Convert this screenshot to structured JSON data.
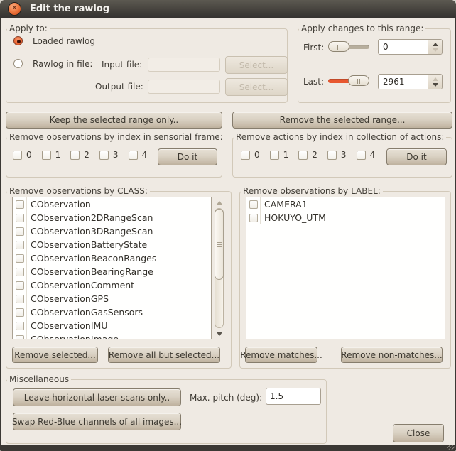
{
  "window": {
    "title": "Edit the rawlog",
    "close_glyph": "✕"
  },
  "apply_to": {
    "label": "Apply to:",
    "radio_loaded_label": "Loaded rawlog",
    "radio_file_label": "Rawlog in file:",
    "input_file_label": "Input file:",
    "output_file_label": "Output file:",
    "input_file_value": "",
    "output_file_value": "",
    "select_input_label": "Select...",
    "select_output_label": "Select..."
  },
  "range": {
    "label": "Apply changes to this range:",
    "first_label": "First:",
    "first_value": "0",
    "last_label": "Last:",
    "last_value": "2961"
  },
  "range_buttons": {
    "keep_label": "Keep the selected range only..",
    "remove_label": "Remove the selected range..."
  },
  "sensorial": {
    "label": "Remove observations by index in sensorial frame:",
    "indices": [
      "0",
      "1",
      "2",
      "3",
      "4"
    ],
    "do_it_label": "Do it"
  },
  "actions": {
    "label": "Remove actions by index in collection of actions:",
    "indices": [
      "0",
      "1",
      "2",
      "3",
      "4"
    ],
    "do_it_label": "Do it"
  },
  "by_class": {
    "label": "Remove observations by CLASS:",
    "items": [
      "CObservation",
      "CObservation2DRangeScan",
      "CObservation3DRangeScan",
      "CObservationBatteryState",
      "CObservationBeaconRanges",
      "CObservationBearingRange",
      "CObservationComment",
      "CObservationGPS",
      "CObservationGasSensors",
      "CObservationIMU",
      "CObservationImage"
    ],
    "remove_selected_label": "Remove selected...",
    "remove_all_but_label": "Remove all but selected..."
  },
  "by_label": {
    "label": "Remove observations by LABEL:",
    "items": [
      "CAMERA1",
      "HOKUYO_UTM"
    ],
    "remove_matches_label": "Remove matches...",
    "remove_non_matches_label": "Remove non-matches..."
  },
  "misc": {
    "label": "Miscellaneous",
    "leave_horizontal_label": "Leave horizontal laser scans only..",
    "max_pitch_label": "Max. pitch (deg):",
    "max_pitch_value": "1.5",
    "swap_rb_label": "Swap Red-Blue channels of all images..."
  },
  "close_button_label": "Close",
  "colors": {
    "accent_orange": "#e85830",
    "titlebar": "#3b3834",
    "dialog_bg": "#efeae3"
  }
}
